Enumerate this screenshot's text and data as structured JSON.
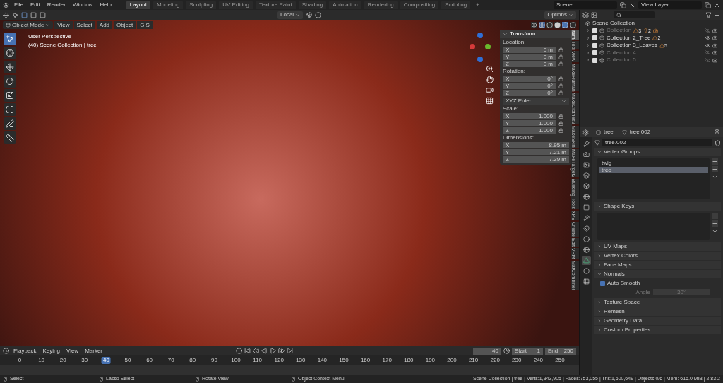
{
  "menu": [
    "File",
    "Edit",
    "Render",
    "Window",
    "Help"
  ],
  "workspaces": [
    {
      "label": "Layout",
      "selected": true
    },
    {
      "label": "Modeling",
      "selected": false
    },
    {
      "label": "Sculpting",
      "selected": false
    },
    {
      "label": "UV Editing",
      "selected": false
    },
    {
      "label": "Texture Paint",
      "selected": false
    },
    {
      "label": "Shading",
      "selected": false
    },
    {
      "label": "Animation",
      "selected": false
    },
    {
      "label": "Rendering",
      "selected": false
    },
    {
      "label": "Compositing",
      "selected": false
    },
    {
      "label": "Scripting",
      "selected": false
    }
  ],
  "add_tab": "+",
  "scene": "Scene",
  "view_layer": "View Layer",
  "tool_header": {
    "orientation": "Local",
    "options": "Options"
  },
  "viewport_header": {
    "mode": "Object Mode",
    "menus": [
      "View",
      "Select",
      "Add",
      "Object",
      "GIS"
    ]
  },
  "viewport": {
    "view_name": "User Perspective",
    "collection_line": "(40) Scene Collection | tree"
  },
  "tools": [
    {
      "selected": true
    },
    {
      "selected": false
    },
    {
      "selected": false
    },
    {
      "selected": false
    },
    {
      "selected": false
    },
    {
      "selected": false
    },
    {
      "selected": false
    },
    {
      "selected": false
    }
  ],
  "transform": {
    "title": "Transform",
    "sections": [
      {
        "kind": "vector",
        "label": "Location:",
        "locks": true,
        "fields": [
          {
            "axis": "X",
            "value": "0 m"
          },
          {
            "axis": "Y",
            "value": "0 m"
          },
          {
            "axis": "Z",
            "value": "0 m"
          }
        ]
      },
      {
        "kind": "vector",
        "label": "Rotation:",
        "locks": true,
        "fields": [
          {
            "axis": "X",
            "value": "0°"
          },
          {
            "axis": "Y",
            "value": "0°"
          },
          {
            "axis": "Z",
            "value": "0°"
          }
        ]
      },
      {
        "kind": "dropdown",
        "value": "XYZ Euler"
      },
      {
        "kind": "vector",
        "label": "Scale:",
        "locks": true,
        "fields": [
          {
            "axis": "X",
            "value": "1.000"
          },
          {
            "axis": "Y",
            "value": "1.000"
          },
          {
            "axis": "Z",
            "value": "1.000"
          }
        ]
      },
      {
        "kind": "vector",
        "label": "Dimensions:",
        "locks": false,
        "fields": [
          {
            "axis": "X",
            "value": "8.95 m"
          },
          {
            "axis": "Y",
            "value": "7.21 m"
          },
          {
            "axis": "Z",
            "value": "7.39 m"
          }
        ]
      }
    ]
  },
  "side_tabs": [
    {
      "label": "Item",
      "selected": true
    },
    {
      "label": "Tool",
      "selected": false
    },
    {
      "label": "View",
      "selected": false
    },
    {
      "label": "MakeHuman",
      "selected": false
    },
    {
      "label": "MakeClothes2",
      "selected": false
    },
    {
      "label": "MakeSkin",
      "selected": false
    },
    {
      "label": "MakeTarget2",
      "selected": false
    },
    {
      "label": "Building Tools",
      "selected": false
    },
    {
      "label": "XPS",
      "selected": false
    },
    {
      "label": "Create",
      "selected": false
    },
    {
      "label": "Edit",
      "selected": false
    },
    {
      "label": "VRM",
      "selected": false
    },
    {
      "label": "MatCombiner",
      "selected": false
    }
  ],
  "outliner": {
    "root": "Scene Collection",
    "children": [
      {
        "name": "Collection",
        "checked": true,
        "dimmed": true,
        "visible": false,
        "badges": [
          {
            "kind": "mesh",
            "count": "3"
          },
          {
            "kind": "light",
            "count": "2"
          },
          {
            "kind": "camera"
          }
        ]
      },
      {
        "name": "Collection 2_Tree",
        "checked": true,
        "dimmed": false,
        "visible": true,
        "badges": [
          {
            "kind": "mesh",
            "count": "2"
          }
        ]
      },
      {
        "name": "Collection 3_Leaves",
        "checked": true,
        "dimmed": false,
        "visible": true,
        "badges": [
          {
            "kind": "mesh",
            "count": "5"
          }
        ]
      },
      {
        "name": "Collection 4",
        "checked": true,
        "dimmed": true,
        "visible": false
      },
      {
        "name": "Collection 5",
        "checked": true,
        "dimmed": true,
        "visible": false
      }
    ]
  },
  "properties": {
    "object": "tree",
    "mesh": "tree.002",
    "datablock": "tree.002",
    "tabs": [
      {
        "selected": false
      },
      {
        "selected": false
      },
      {
        "selected": false
      },
      {
        "selected": false
      },
      {
        "selected": false
      },
      {
        "selected": false
      },
      {
        "selected": false
      },
      {
        "selected": false
      },
      {
        "selected": false
      },
      {
        "selected": false
      },
      {
        "selected": false
      },
      {
        "selected": true
      },
      {
        "selected": false
      },
      {
        "selected": false
      }
    ],
    "panels": [
      {
        "kind": "list",
        "title": "Vertex Groups",
        "expanded": true,
        "items": [
          {
            "name": "twig",
            "selected": false
          },
          {
            "name": "tree",
            "selected": true
          }
        ]
      },
      {
        "kind": "list",
        "title": "Shape Keys",
        "expanded": true
      },
      {
        "title": "UV Maps",
        "expanded": false
      },
      {
        "title": "Vertex Colors",
        "expanded": false
      },
      {
        "title": "Face Maps",
        "expanded": false
      },
      {
        "kind": "normals",
        "title": "Normals",
        "expanded": true,
        "auto_smooth": {
          "label": "Auto Smooth",
          "checked": true
        },
        "angle_label": "Angle",
        "angle": "30°"
      },
      {
        "title": "Texture Space",
        "expanded": false
      },
      {
        "title": "Remesh",
        "expanded": false
      },
      {
        "title": "Geometry Data",
        "expanded": false
      },
      {
        "title": "Custom Properties",
        "expanded": false
      }
    ]
  },
  "timeline": {
    "menus": [
      "Playback",
      "Keying",
      "View",
      "Marker"
    ],
    "frame": "40",
    "start_label": "Start",
    "start": "1",
    "end_label": "End",
    "end": "250",
    "ticks": [
      {
        "label": "0",
        "selected": false
      },
      {
        "label": "10",
        "selected": false
      },
      {
        "label": "20",
        "selected": false
      },
      {
        "label": "30",
        "selected": false
      },
      {
        "label": "40",
        "selected": true
      },
      {
        "label": "50",
        "selected": false
      },
      {
        "label": "60",
        "selected": false
      },
      {
        "label": "70",
        "selected": false
      },
      {
        "label": "80",
        "selected": false
      },
      {
        "label": "90",
        "selected": false
      },
      {
        "label": "100",
        "selected": false
      },
      {
        "label": "110",
        "selected": false
      },
      {
        "label": "120",
        "selected": false
      },
      {
        "label": "130",
        "selected": false
      },
      {
        "label": "140",
        "selected": false
      },
      {
        "label": "150",
        "selected": false
      },
      {
        "label": "160",
        "selected": false
      },
      {
        "label": "170",
        "selected": false
      },
      {
        "label": "180",
        "selected": false
      },
      {
        "label": "190",
        "selected": false
      },
      {
        "label": "200",
        "selected": false
      },
      {
        "label": "210",
        "selected": false
      },
      {
        "label": "220",
        "selected": false
      },
      {
        "label": "230",
        "selected": false
      },
      {
        "label": "240",
        "selected": false
      },
      {
        "label": "250",
        "selected": false
      }
    ]
  },
  "status": {
    "hints": [
      "Select",
      "Lasso Select",
      "Rotate View",
      "Object Context Menu"
    ],
    "stats": "Scene Collection | tree | Verts:1,343,905 | Faces:753,055 | Tris:1,600,649 | Objects:0/6 | Mem: 616.0 MiB | 2.83.2"
  }
}
